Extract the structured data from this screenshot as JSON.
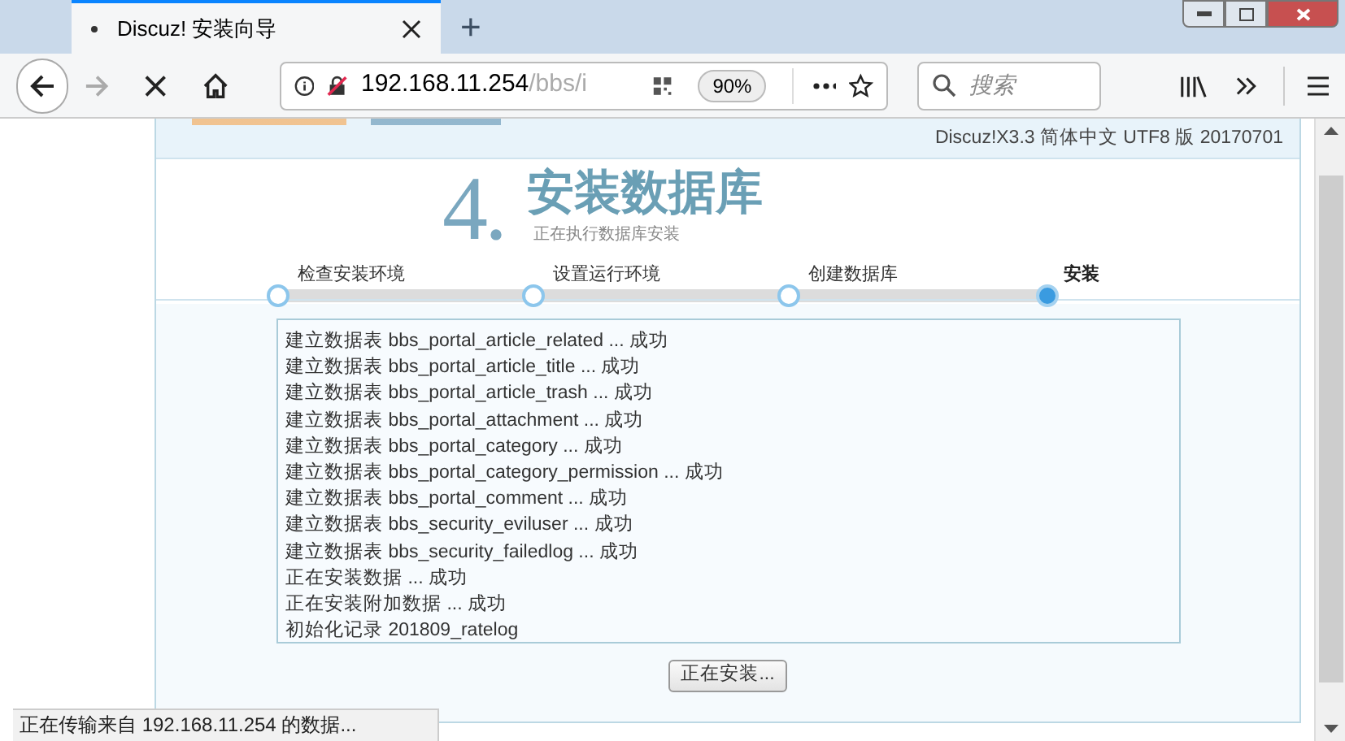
{
  "browser": {
    "tab_title": "Discuz! 安装向导",
    "new_tab": "+",
    "url_host": "192.168.11.254",
    "url_path": "/bbs/i",
    "zoom": "90%",
    "search_placeholder": "搜索"
  },
  "header": {
    "version": "Discuz!X3.3 简体中文 UTF8 版 20170701"
  },
  "step": {
    "number": "4.",
    "title": "安装数据库",
    "subtitle": "正在执行数据库安装"
  },
  "steps": [
    {
      "label": "检查安装环境",
      "selected": false
    },
    {
      "label": "设置运行环境",
      "selected": false
    },
    {
      "label": "创建数据库",
      "selected": false
    },
    {
      "label": "安装",
      "selected": true
    }
  ],
  "log": [
    "建立数据表 bbs_portal_article_related ... 成功",
    "建立数据表 bbs_portal_article_title ... 成功",
    "建立数据表 bbs_portal_article_trash ... 成功",
    "建立数据表 bbs_portal_attachment ... 成功",
    "建立数据表 bbs_portal_category ... 成功",
    "建立数据表 bbs_portal_category_permission ... 成功",
    "建立数据表 bbs_portal_comment ... 成功",
    "建立数据表 bbs_security_eviluser ... 成功",
    "建立数据表 bbs_security_failedlog ... 成功",
    "正在安装数据 ... 成功",
    "正在安装附加数据 ... 成功",
    "初始化记录 201809_ratelog"
  ],
  "button": "正在安装...",
  "status_bar": "正在传输来自 192.168.11.254 的数据..."
}
